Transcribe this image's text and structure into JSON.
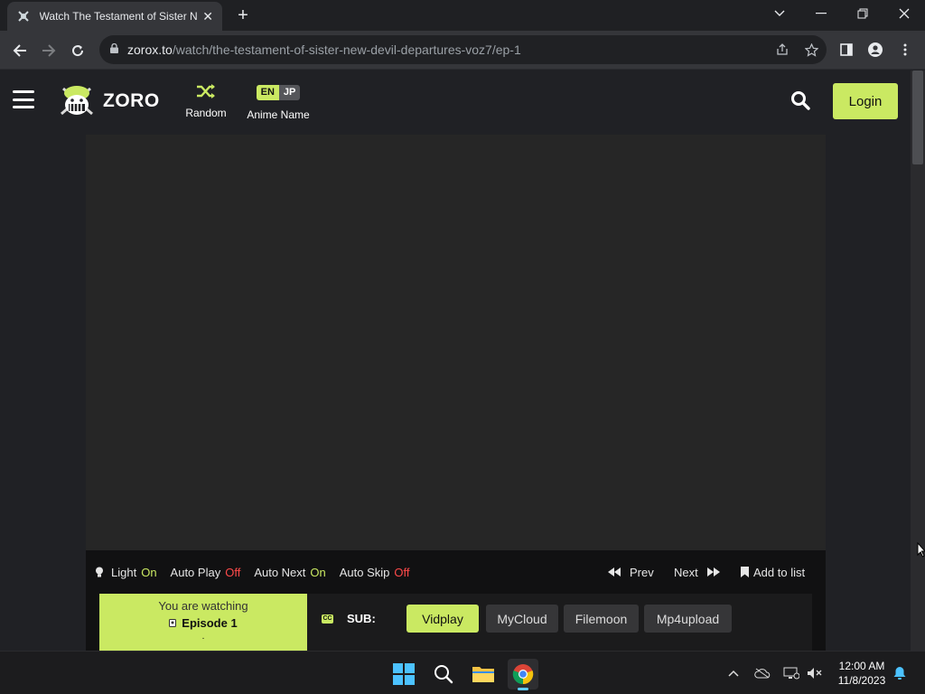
{
  "browser": {
    "tab_title": "Watch The Testament of Sister New Devil Departures",
    "tab_close": "✕",
    "new_tab": "+",
    "url_host": "zorox.to",
    "url_path": "/watch/the-testament-of-sister-new-devil-departures-voz7/ep-1"
  },
  "site": {
    "brand": "ZORO",
    "random_label": "Random",
    "lang_en": "EN",
    "lang_jp": "JP",
    "lang_label": "Anime Name",
    "login_label": "Login",
    "accent_color": "#cae962"
  },
  "player_controls": {
    "light_label": "Light",
    "light_state": "On",
    "autoplay_label": "Auto Play",
    "autoplay_state": "Off",
    "autonext_label": "Auto Next",
    "autonext_state": "On",
    "autoskip_label": "Auto Skip",
    "autoskip_state": "Off",
    "prev_label": "Prev",
    "next_label": "Next",
    "addlist_label": "Add to list"
  },
  "episode": {
    "watching_label": "You are watching",
    "episode_label": "Episode 1",
    "dot": ".",
    "sub_label": "SUB:",
    "cc_label": "CC",
    "servers": [
      "Vidplay",
      "MyCloud",
      "Filemoon",
      "Mp4upload"
    ],
    "active_server": "Vidplay"
  },
  "taskbar": {
    "time": "12:00 AM",
    "date": "11/8/2023",
    "tray_chevron": "^"
  }
}
